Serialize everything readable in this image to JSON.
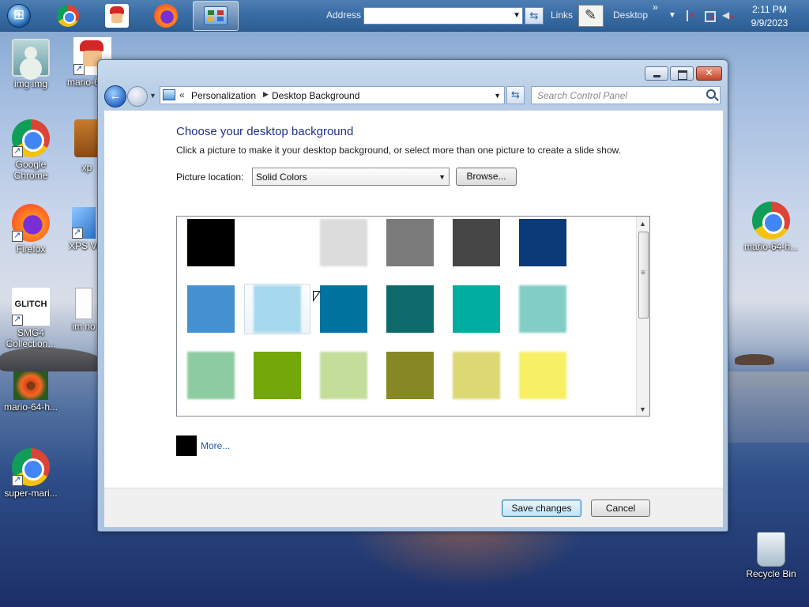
{
  "taskbar": {
    "address_label": "Address",
    "address_value": "",
    "links_label": "Links",
    "desktop_label": "Desktop",
    "overflow_glyph": "»",
    "clock_time": "2:11 PM",
    "clock_date": "9/9/2023",
    "pinned": [
      {
        "name": "start-orb-icon"
      },
      {
        "name": "chrome-icon"
      },
      {
        "name": "mario-icon"
      },
      {
        "name": "firefox-icon"
      },
      {
        "name": "control-panel-icon"
      }
    ]
  },
  "desktop": {
    "icons": [
      {
        "label": "img img",
        "icon": "user-picture-icon"
      },
      {
        "label": "mario-6",
        "icon": "mario-icon"
      },
      {
        "label": "Google Chrome",
        "icon": "chrome-icon"
      },
      {
        "label": "xp",
        "icon": "briefcase-icon"
      },
      {
        "label": "Firefox",
        "icon": "firefox-icon"
      },
      {
        "label": "XPS Vi",
        "icon": "xps-viewer-icon"
      },
      {
        "label": "SMG4 Collection...",
        "icon": "glitch-icon"
      },
      {
        "label": "im no",
        "icon": "document-icon"
      },
      {
        "label": "mario-64-h...",
        "icon": "flower-icon"
      },
      {
        "label": "super-mari...",
        "icon": "chrome-icon"
      },
      {
        "label": "mario-64-h...",
        "icon": "chrome-icon"
      },
      {
        "label": "Recycle Bin",
        "icon": "recycle-bin-icon"
      }
    ]
  },
  "window": {
    "breadcrumb": {
      "root_glyph": "«",
      "items": [
        "Personalization",
        "Desktop Background"
      ]
    },
    "search_placeholder": "Search Control Panel",
    "title": "Choose your desktop background",
    "description": "Click a picture to make it your desktop background, or select more than one picture to create a slide show.",
    "picture_location_label": "Picture location:",
    "picture_location_value": "Solid Colors",
    "browse_label": "Browse...",
    "more_label": "More...",
    "save_label": "Save changes",
    "cancel_label": "Cancel",
    "selected_swatch_index": 7,
    "swatches": [
      {
        "color": "#000000"
      },
      {
        "color": "#ffffff"
      },
      {
        "color": "#dcdcdc"
      },
      {
        "color": "#7b7b7b"
      },
      {
        "color": "#464646"
      },
      {
        "color": "#0b3a78"
      },
      {
        "color": "#4592d3"
      },
      {
        "color": "#a6d9ee"
      },
      {
        "color": "#00739e"
      },
      {
        "color": "#0f6b6b"
      },
      {
        "color": "#00ad9f"
      },
      {
        "color": "#82cdc6"
      },
      {
        "color": "#8ccca0"
      },
      {
        "color": "#73a80b"
      },
      {
        "color": "#c3dd9a"
      },
      {
        "color": "#868823"
      },
      {
        "color": "#dcd874"
      },
      {
        "color": "#f8f064"
      }
    ],
    "more_swatch_color": "#000000"
  }
}
